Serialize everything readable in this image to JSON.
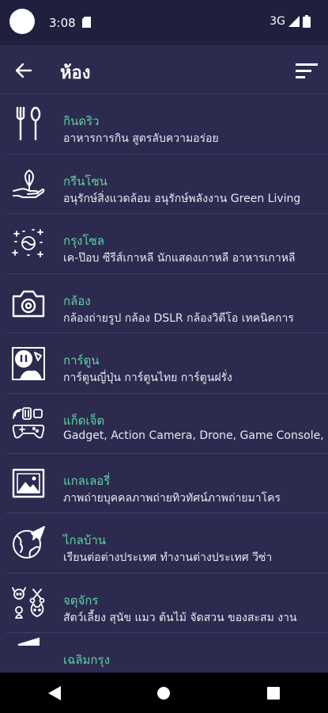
{
  "status_bar": {
    "time": "3:08",
    "network": "3G"
  },
  "header": {
    "title": "ห้อง"
  },
  "rooms": [
    {
      "name": "กินดริว",
      "description": "อาหารการกิน สูตรลับความอร่อย",
      "icon": "fork-spoon-icon"
    },
    {
      "name": "กรีนโซน",
      "description": "อนุรักษ์สิ่งแวดล้อม อนุรักษ์พลังงาน Green Living",
      "icon": "plant-hand-icon"
    },
    {
      "name": "กรุงโซล",
      "description": "เค-ป๊อบ ซีรีส์เกาหลี นักแสดงเกาหลี อาหารเกาหลี",
      "icon": "korea-sparkle-icon"
    },
    {
      "name": "กล้อง",
      "description": "กล้องถ่ายรูป กล้อง DSLR กล้องวิดีโอ เทคนิคการ",
      "icon": "camera-icon"
    },
    {
      "name": "การ์ตูน",
      "description": "การ์ตูนญี่ปุ่น การ์ตูนไทย การ์ตูนฝรั่ง",
      "icon": "cartoon-icon"
    },
    {
      "name": "แก็ดเจ็ต",
      "description": "Gadget, Action Camera, Drone, Game Console,",
      "icon": "gadget-icon"
    },
    {
      "name": "แกลเลอรี่",
      "description": "ภาพถ่ายบุคคลภาพถ่ายทิวทัศน์ภาพถ่ายมาโคร",
      "icon": "gallery-icon"
    },
    {
      "name": "ไกลบ้าน",
      "description": "เรียนต่อต่างประเทศ ทำงานต่างประเทศ วีซ่า",
      "icon": "globe-plane-icon"
    },
    {
      "name": "จตุจักร",
      "description": "สัตว์เลี้ยง สุนัข แมว ต้นไม้ จัดสวน ของสะสม งาน",
      "icon": "pets-icon"
    },
    {
      "name": "เฉลิมกรุง",
      "description": "",
      "icon": "theater-icon"
    }
  ]
}
